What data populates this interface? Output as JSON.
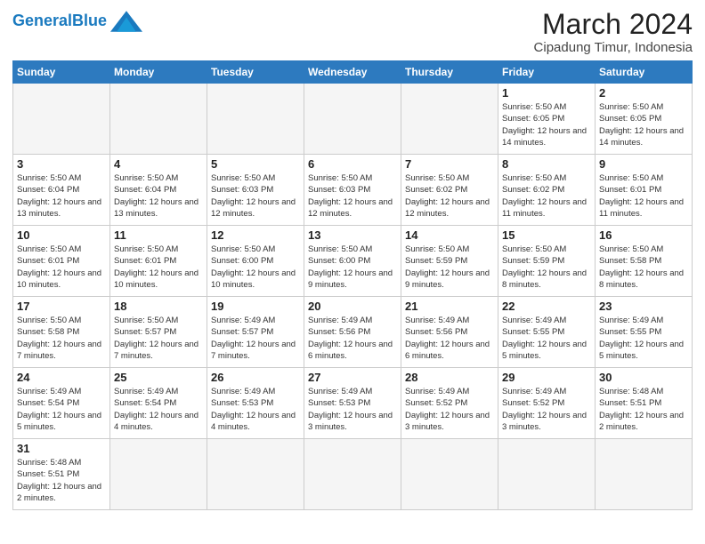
{
  "header": {
    "logo_general": "General",
    "logo_blue": "Blue",
    "month_title": "March 2024",
    "location": "Cipadung Timur, Indonesia"
  },
  "weekdays": [
    "Sunday",
    "Monday",
    "Tuesday",
    "Wednesday",
    "Thursday",
    "Friday",
    "Saturday"
  ],
  "weeks": [
    [
      {
        "day": "",
        "info": ""
      },
      {
        "day": "",
        "info": ""
      },
      {
        "day": "",
        "info": ""
      },
      {
        "day": "",
        "info": ""
      },
      {
        "day": "",
        "info": ""
      },
      {
        "day": "1",
        "info": "Sunrise: 5:50 AM\nSunset: 6:05 PM\nDaylight: 12 hours and 14 minutes."
      },
      {
        "day": "2",
        "info": "Sunrise: 5:50 AM\nSunset: 6:05 PM\nDaylight: 12 hours and 14 minutes."
      }
    ],
    [
      {
        "day": "3",
        "info": "Sunrise: 5:50 AM\nSunset: 6:04 PM\nDaylight: 12 hours and 13 minutes."
      },
      {
        "day": "4",
        "info": "Sunrise: 5:50 AM\nSunset: 6:04 PM\nDaylight: 12 hours and 13 minutes."
      },
      {
        "day": "5",
        "info": "Sunrise: 5:50 AM\nSunset: 6:03 PM\nDaylight: 12 hours and 12 minutes."
      },
      {
        "day": "6",
        "info": "Sunrise: 5:50 AM\nSunset: 6:03 PM\nDaylight: 12 hours and 12 minutes."
      },
      {
        "day": "7",
        "info": "Sunrise: 5:50 AM\nSunset: 6:02 PM\nDaylight: 12 hours and 12 minutes."
      },
      {
        "day": "8",
        "info": "Sunrise: 5:50 AM\nSunset: 6:02 PM\nDaylight: 12 hours and 11 minutes."
      },
      {
        "day": "9",
        "info": "Sunrise: 5:50 AM\nSunset: 6:01 PM\nDaylight: 12 hours and 11 minutes."
      }
    ],
    [
      {
        "day": "10",
        "info": "Sunrise: 5:50 AM\nSunset: 6:01 PM\nDaylight: 12 hours and 10 minutes."
      },
      {
        "day": "11",
        "info": "Sunrise: 5:50 AM\nSunset: 6:01 PM\nDaylight: 12 hours and 10 minutes."
      },
      {
        "day": "12",
        "info": "Sunrise: 5:50 AM\nSunset: 6:00 PM\nDaylight: 12 hours and 10 minutes."
      },
      {
        "day": "13",
        "info": "Sunrise: 5:50 AM\nSunset: 6:00 PM\nDaylight: 12 hours and 9 minutes."
      },
      {
        "day": "14",
        "info": "Sunrise: 5:50 AM\nSunset: 5:59 PM\nDaylight: 12 hours and 9 minutes."
      },
      {
        "day": "15",
        "info": "Sunrise: 5:50 AM\nSunset: 5:59 PM\nDaylight: 12 hours and 8 minutes."
      },
      {
        "day": "16",
        "info": "Sunrise: 5:50 AM\nSunset: 5:58 PM\nDaylight: 12 hours and 8 minutes."
      }
    ],
    [
      {
        "day": "17",
        "info": "Sunrise: 5:50 AM\nSunset: 5:58 PM\nDaylight: 12 hours and 7 minutes."
      },
      {
        "day": "18",
        "info": "Sunrise: 5:50 AM\nSunset: 5:57 PM\nDaylight: 12 hours and 7 minutes."
      },
      {
        "day": "19",
        "info": "Sunrise: 5:49 AM\nSunset: 5:57 PM\nDaylight: 12 hours and 7 minutes."
      },
      {
        "day": "20",
        "info": "Sunrise: 5:49 AM\nSunset: 5:56 PM\nDaylight: 12 hours and 6 minutes."
      },
      {
        "day": "21",
        "info": "Sunrise: 5:49 AM\nSunset: 5:56 PM\nDaylight: 12 hours and 6 minutes."
      },
      {
        "day": "22",
        "info": "Sunrise: 5:49 AM\nSunset: 5:55 PM\nDaylight: 12 hours and 5 minutes."
      },
      {
        "day": "23",
        "info": "Sunrise: 5:49 AM\nSunset: 5:55 PM\nDaylight: 12 hours and 5 minutes."
      }
    ],
    [
      {
        "day": "24",
        "info": "Sunrise: 5:49 AM\nSunset: 5:54 PM\nDaylight: 12 hours and 5 minutes."
      },
      {
        "day": "25",
        "info": "Sunrise: 5:49 AM\nSunset: 5:54 PM\nDaylight: 12 hours and 4 minutes."
      },
      {
        "day": "26",
        "info": "Sunrise: 5:49 AM\nSunset: 5:53 PM\nDaylight: 12 hours and 4 minutes."
      },
      {
        "day": "27",
        "info": "Sunrise: 5:49 AM\nSunset: 5:53 PM\nDaylight: 12 hours and 3 minutes."
      },
      {
        "day": "28",
        "info": "Sunrise: 5:49 AM\nSunset: 5:52 PM\nDaylight: 12 hours and 3 minutes."
      },
      {
        "day": "29",
        "info": "Sunrise: 5:49 AM\nSunset: 5:52 PM\nDaylight: 12 hours and 3 minutes."
      },
      {
        "day": "30",
        "info": "Sunrise: 5:48 AM\nSunset: 5:51 PM\nDaylight: 12 hours and 2 minutes."
      }
    ],
    [
      {
        "day": "31",
        "info": "Sunrise: 5:48 AM\nSunset: 5:51 PM\nDaylight: 12 hours and 2 minutes."
      },
      {
        "day": "",
        "info": ""
      },
      {
        "day": "",
        "info": ""
      },
      {
        "day": "",
        "info": ""
      },
      {
        "day": "",
        "info": ""
      },
      {
        "day": "",
        "info": ""
      },
      {
        "day": "",
        "info": ""
      }
    ]
  ]
}
